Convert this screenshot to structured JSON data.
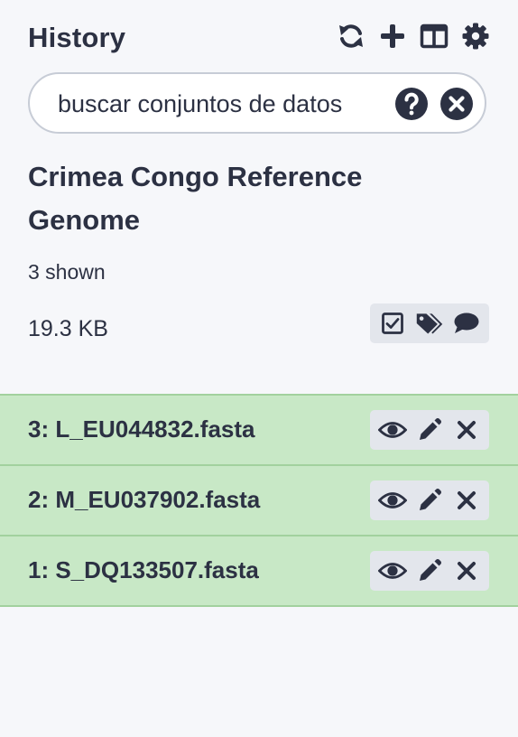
{
  "header": {
    "title": "History",
    "icons": [
      "refresh-icon",
      "plus-icon",
      "columns-icon",
      "gear-icon"
    ]
  },
  "search": {
    "placeholder": "buscar conjuntos de datos",
    "value": ""
  },
  "history": {
    "name": "Crimea Congo Reference Genome",
    "shown": "3 shown",
    "size": "19.3 KB"
  },
  "datasets": [
    {
      "label": "3: L_EU044832.fasta"
    },
    {
      "label": "2: M_EU037902.fasta"
    },
    {
      "label": "1: S_DQ133507.fasta"
    }
  ],
  "colors": {
    "text": "#2c3143",
    "row_ok": "#c8e8c6",
    "row_border": "#a2d19e",
    "action_bg": "#e3e6ec"
  }
}
